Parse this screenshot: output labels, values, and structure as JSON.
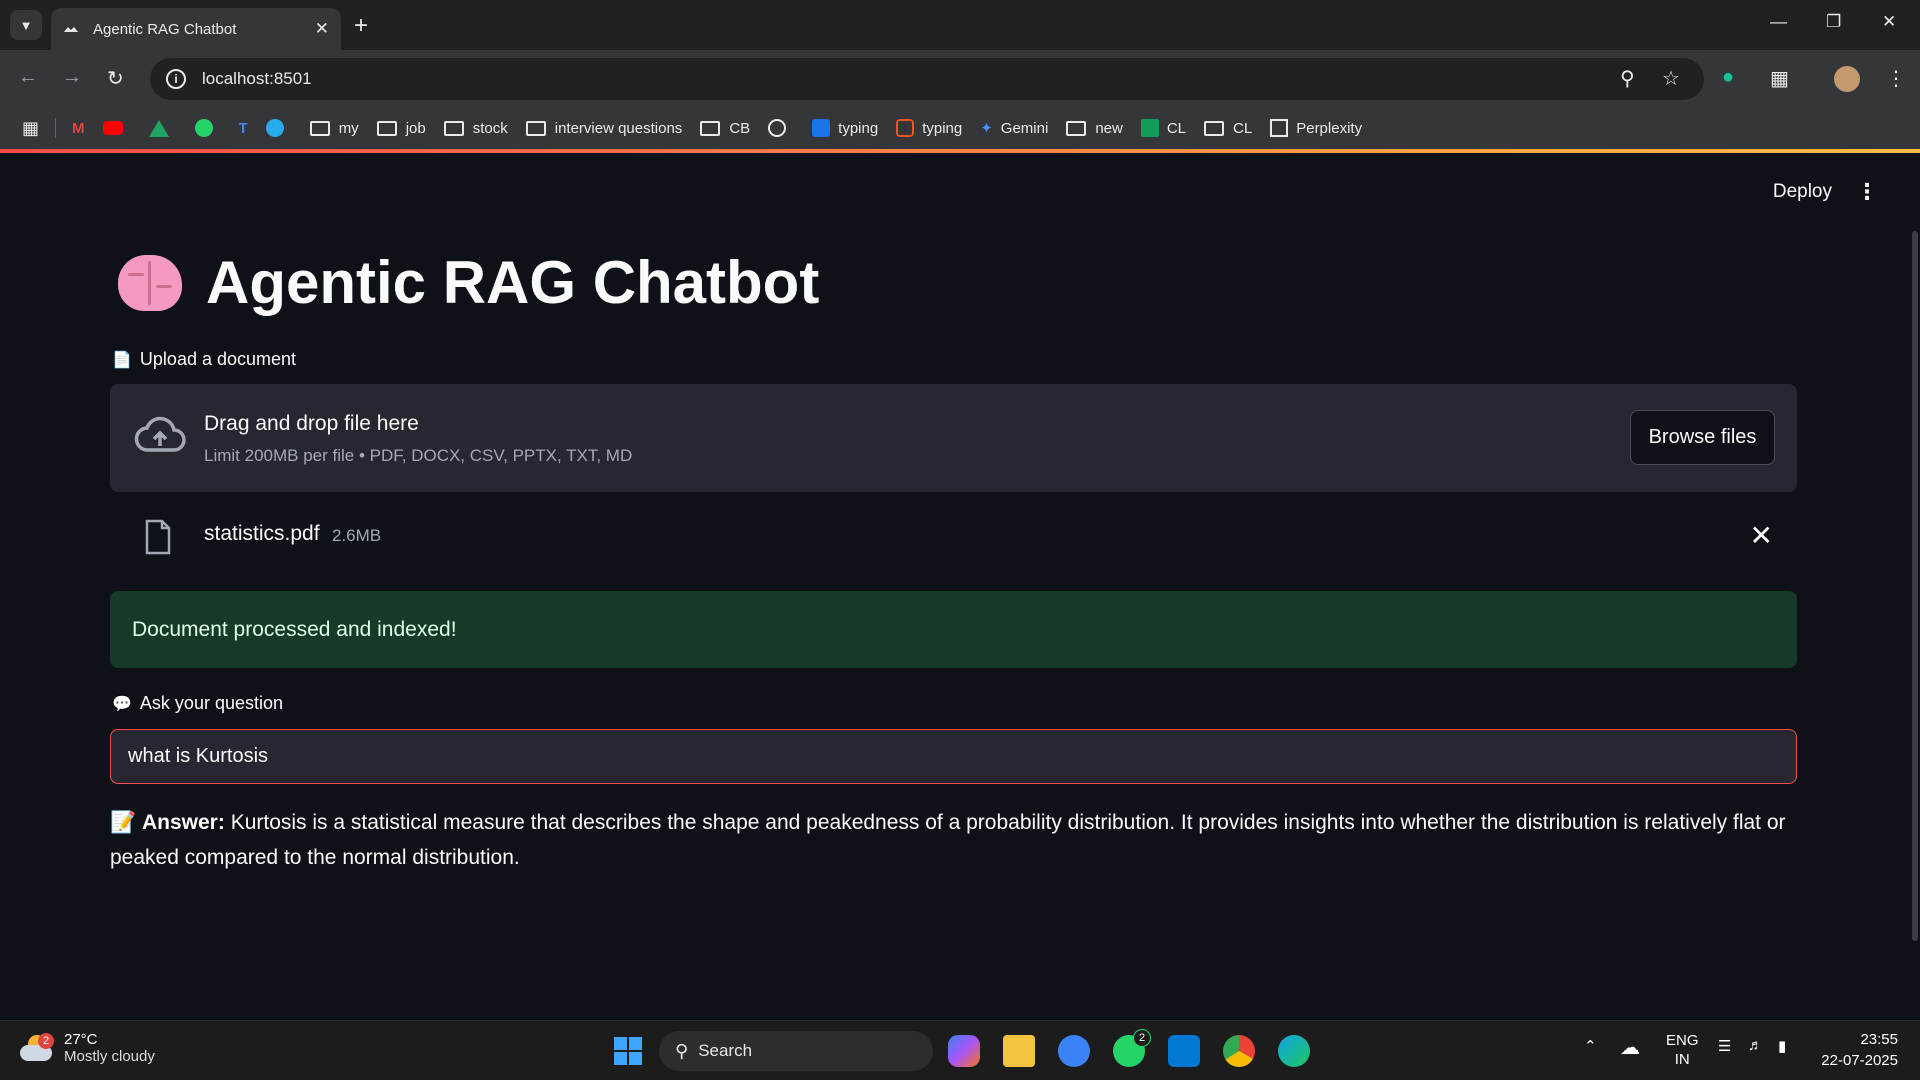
{
  "browser": {
    "tab_title": "Agentic RAG Chatbot",
    "url": "localhost:8501",
    "bookmarks": [
      "my",
      "job",
      "stock",
      "interview questions",
      "CB",
      "typing",
      "typing",
      "Gemini",
      "new",
      "CL",
      "CL",
      "Perplexity"
    ]
  },
  "app": {
    "deploy_label": "Deploy",
    "title": "Agentic RAG Chatbot",
    "upload_label": "Upload a document",
    "dropzone_title": "Drag and drop file here",
    "dropzone_limit": "Limit 200MB per file • PDF, DOCX, CSV, PPTX, TXT, MD",
    "browse_label": "Browse files",
    "file_name": "statistics.pdf",
    "file_size": "2.6MB",
    "success_message": "Document processed and indexed!",
    "question_label": "Ask your question",
    "question_value": "what is Kurtosis",
    "answer_label": "Answer:",
    "answer_text": "Kurtosis is a statistical measure that describes the shape and peakedness of a probability distribution. It provides insights into whether the distribution is relatively flat or peaked compared to the normal distribution."
  },
  "taskbar": {
    "weather_badge": "2",
    "temperature": "27°C",
    "weather_desc": "Mostly cloudy",
    "search_label": "Search",
    "whatsapp_badge": "2",
    "lang_1": "ENG",
    "lang_2": "IN",
    "time": "23:55",
    "date": "22-07-2025"
  },
  "colors": {
    "accent": "#ff4b4b",
    "success_bg": "#173928",
    "app_bg": "#0e1117",
    "panel_bg": "#262730"
  }
}
